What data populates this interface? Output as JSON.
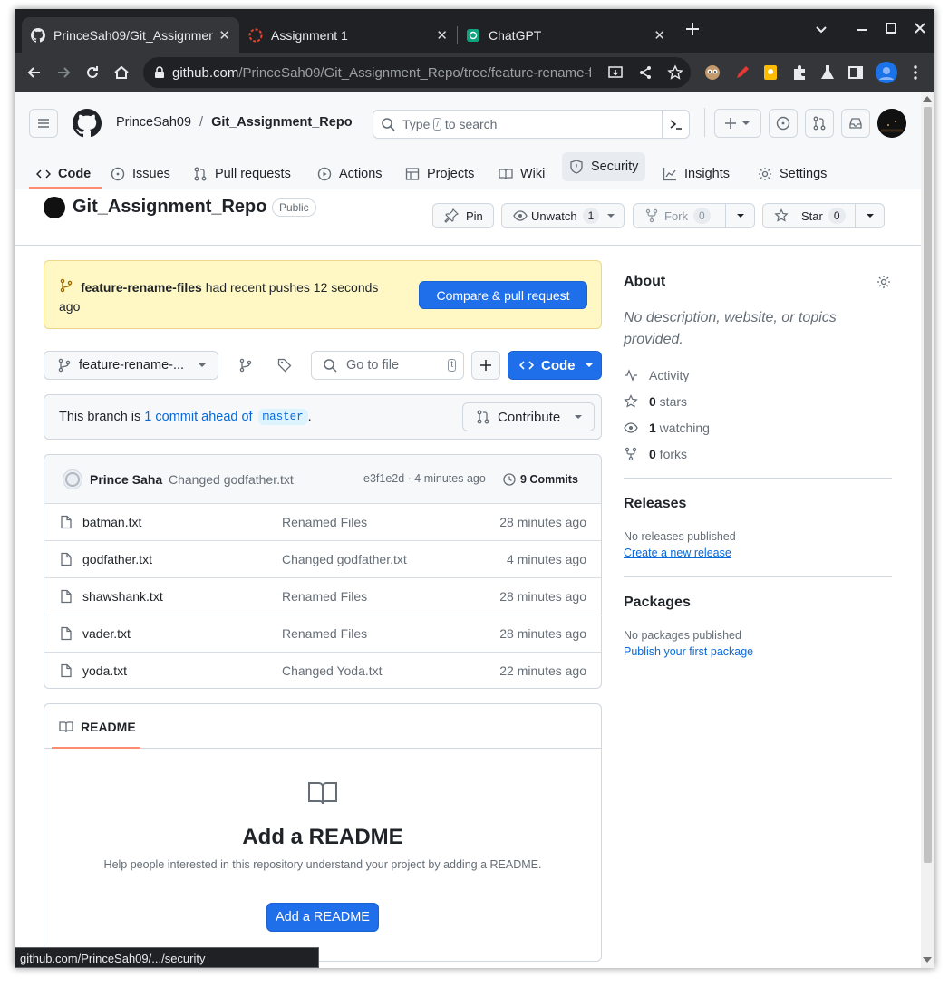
{
  "browser": {
    "tabs": [
      {
        "title": "PrinceSah09/Git_Assignmen",
        "icon": "github-icon"
      },
      {
        "title": "Assignment 1",
        "icon": "loading-icon"
      },
      {
        "title": "ChatGPT",
        "icon": "chatgpt-icon"
      }
    ],
    "url_host": "github.com",
    "url_path": "/PrinceSah09/Git_Assignment_Repo/tree/feature-rename-f..."
  },
  "header": {
    "owner": "PrinceSah09",
    "slash": "/",
    "repo": "Git_Assignment_Repo",
    "search_pre": "Type",
    "search_key": "/",
    "search_post": "to search"
  },
  "nav": {
    "items": [
      "Code",
      "Issues",
      "Pull requests",
      "Actions",
      "Projects",
      "Wiki",
      "Security",
      "Insights",
      "Settings"
    ]
  },
  "repo": {
    "name": "Git_Assignment_Repo",
    "visibility": "Public",
    "pin_label": "Pin",
    "unwatch_label": "Unwatch",
    "watch_count": "1",
    "fork_label": "Fork",
    "fork_count": "0",
    "star_label": "Star",
    "star_count": "0"
  },
  "banner": {
    "branch": "feature-rename-files",
    "text_a": " had recent pushes 12 seconds",
    "text_b": "ago",
    "button": "Compare & pull request"
  },
  "toolbar": {
    "branch": "feature-rename-...",
    "goto_placeholder": "Go to file",
    "goto_key": "t",
    "code_label": "Code"
  },
  "ahead": {
    "pre": "This branch is ",
    "link": "1 commit ahead of",
    "base": "master",
    "post": ".",
    "contribute": "Contribute"
  },
  "commit": {
    "author": "Prince Saha",
    "message": "Changed godfather.txt",
    "meta": "e3f1e2d · 4 minutes ago",
    "commits": "9 Commits"
  },
  "files": [
    {
      "name": "batman.txt",
      "message": "Renamed Files",
      "age": "28 minutes ago"
    },
    {
      "name": "godfather.txt",
      "message": "Changed godfather.txt",
      "age": "4 minutes ago"
    },
    {
      "name": "shawshank.txt",
      "message": "Renamed Files",
      "age": "28 minutes ago"
    },
    {
      "name": "vader.txt",
      "message": "Renamed Files",
      "age": "28 minutes ago"
    },
    {
      "name": "yoda.txt",
      "message": "Changed Yoda.txt",
      "age": "22 minutes ago"
    }
  ],
  "readme": {
    "tab": "README",
    "title": "Add a README",
    "desc": "Help people interested in this repository understand your project by adding a README.",
    "button": "Add a README"
  },
  "about": {
    "title": "About",
    "desc": "No description, website, or topics provided.",
    "activity": "Activity",
    "stars_n": "0",
    "stars": " stars",
    "watching_n": "1",
    "watching": " watching",
    "forks_n": "0",
    "forks": " forks"
  },
  "releases": {
    "title": "Releases",
    "none": "No releases published",
    "link": "Create a new release"
  },
  "packages": {
    "title": "Packages",
    "none": "No packages published",
    "link": "Publish your first package"
  },
  "status_bar": "github.com/PrinceSah09/.../security"
}
